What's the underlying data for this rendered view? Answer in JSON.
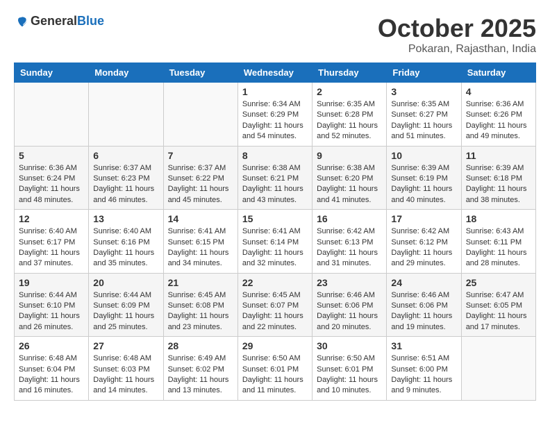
{
  "header": {
    "logo_general": "General",
    "logo_blue": "Blue",
    "month": "October 2025",
    "location": "Pokaran, Rajasthan, India"
  },
  "days_of_week": [
    "Sunday",
    "Monday",
    "Tuesday",
    "Wednesday",
    "Thursday",
    "Friday",
    "Saturday"
  ],
  "weeks": [
    [
      {
        "day": "",
        "info": ""
      },
      {
        "day": "",
        "info": ""
      },
      {
        "day": "",
        "info": ""
      },
      {
        "day": "1",
        "info": "Sunrise: 6:34 AM\nSunset: 6:29 PM\nDaylight: 11 hours\nand 54 minutes."
      },
      {
        "day": "2",
        "info": "Sunrise: 6:35 AM\nSunset: 6:28 PM\nDaylight: 11 hours\nand 52 minutes."
      },
      {
        "day": "3",
        "info": "Sunrise: 6:35 AM\nSunset: 6:27 PM\nDaylight: 11 hours\nand 51 minutes."
      },
      {
        "day": "4",
        "info": "Sunrise: 6:36 AM\nSunset: 6:26 PM\nDaylight: 11 hours\nand 49 minutes."
      }
    ],
    [
      {
        "day": "5",
        "info": "Sunrise: 6:36 AM\nSunset: 6:24 PM\nDaylight: 11 hours\nand 48 minutes."
      },
      {
        "day": "6",
        "info": "Sunrise: 6:37 AM\nSunset: 6:23 PM\nDaylight: 11 hours\nand 46 minutes."
      },
      {
        "day": "7",
        "info": "Sunrise: 6:37 AM\nSunset: 6:22 PM\nDaylight: 11 hours\nand 45 minutes."
      },
      {
        "day": "8",
        "info": "Sunrise: 6:38 AM\nSunset: 6:21 PM\nDaylight: 11 hours\nand 43 minutes."
      },
      {
        "day": "9",
        "info": "Sunrise: 6:38 AM\nSunset: 6:20 PM\nDaylight: 11 hours\nand 41 minutes."
      },
      {
        "day": "10",
        "info": "Sunrise: 6:39 AM\nSunset: 6:19 PM\nDaylight: 11 hours\nand 40 minutes."
      },
      {
        "day": "11",
        "info": "Sunrise: 6:39 AM\nSunset: 6:18 PM\nDaylight: 11 hours\nand 38 minutes."
      }
    ],
    [
      {
        "day": "12",
        "info": "Sunrise: 6:40 AM\nSunset: 6:17 PM\nDaylight: 11 hours\nand 37 minutes."
      },
      {
        "day": "13",
        "info": "Sunrise: 6:40 AM\nSunset: 6:16 PM\nDaylight: 11 hours\nand 35 minutes."
      },
      {
        "day": "14",
        "info": "Sunrise: 6:41 AM\nSunset: 6:15 PM\nDaylight: 11 hours\nand 34 minutes."
      },
      {
        "day": "15",
        "info": "Sunrise: 6:41 AM\nSunset: 6:14 PM\nDaylight: 11 hours\nand 32 minutes."
      },
      {
        "day": "16",
        "info": "Sunrise: 6:42 AM\nSunset: 6:13 PM\nDaylight: 11 hours\nand 31 minutes."
      },
      {
        "day": "17",
        "info": "Sunrise: 6:42 AM\nSunset: 6:12 PM\nDaylight: 11 hours\nand 29 minutes."
      },
      {
        "day": "18",
        "info": "Sunrise: 6:43 AM\nSunset: 6:11 PM\nDaylight: 11 hours\nand 28 minutes."
      }
    ],
    [
      {
        "day": "19",
        "info": "Sunrise: 6:44 AM\nSunset: 6:10 PM\nDaylight: 11 hours\nand 26 minutes."
      },
      {
        "day": "20",
        "info": "Sunrise: 6:44 AM\nSunset: 6:09 PM\nDaylight: 11 hours\nand 25 minutes."
      },
      {
        "day": "21",
        "info": "Sunrise: 6:45 AM\nSunset: 6:08 PM\nDaylight: 11 hours\nand 23 minutes."
      },
      {
        "day": "22",
        "info": "Sunrise: 6:45 AM\nSunset: 6:07 PM\nDaylight: 11 hours\nand 22 minutes."
      },
      {
        "day": "23",
        "info": "Sunrise: 6:46 AM\nSunset: 6:06 PM\nDaylight: 11 hours\nand 20 minutes."
      },
      {
        "day": "24",
        "info": "Sunrise: 6:46 AM\nSunset: 6:06 PM\nDaylight: 11 hours\nand 19 minutes."
      },
      {
        "day": "25",
        "info": "Sunrise: 6:47 AM\nSunset: 6:05 PM\nDaylight: 11 hours\nand 17 minutes."
      }
    ],
    [
      {
        "day": "26",
        "info": "Sunrise: 6:48 AM\nSunset: 6:04 PM\nDaylight: 11 hours\nand 16 minutes."
      },
      {
        "day": "27",
        "info": "Sunrise: 6:48 AM\nSunset: 6:03 PM\nDaylight: 11 hours\nand 14 minutes."
      },
      {
        "day": "28",
        "info": "Sunrise: 6:49 AM\nSunset: 6:02 PM\nDaylight: 11 hours\nand 13 minutes."
      },
      {
        "day": "29",
        "info": "Sunrise: 6:50 AM\nSunset: 6:01 PM\nDaylight: 11 hours\nand 11 minutes."
      },
      {
        "day": "30",
        "info": "Sunrise: 6:50 AM\nSunset: 6:01 PM\nDaylight: 11 hours\nand 10 minutes."
      },
      {
        "day": "31",
        "info": "Sunrise: 6:51 AM\nSunset: 6:00 PM\nDaylight: 11 hours\nand 9 minutes."
      },
      {
        "day": "",
        "info": ""
      }
    ]
  ]
}
